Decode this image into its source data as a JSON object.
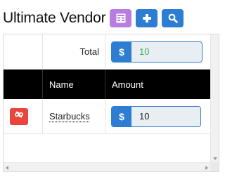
{
  "header": {
    "title": "Ultimate Vendor",
    "buttons": [
      {
        "icon": "table-icon",
        "color": "#b77ee0"
      },
      {
        "icon": "plus-icon",
        "color": "#2d7dd2"
      },
      {
        "icon": "search-icon",
        "color": "#2d7dd2"
      }
    ]
  },
  "table": {
    "total_label": "Total",
    "total": {
      "currency_symbol": "$",
      "value": "10",
      "value_color": "#3fae5a"
    },
    "columns": [
      "",
      "Name",
      "Amount"
    ],
    "rows": [
      {
        "name": "Starbucks",
        "currency_symbol": "$",
        "amount": "10",
        "delete_icon": "unlink-icon"
      }
    ]
  },
  "colors": {
    "accent_blue": "#2d7dd2",
    "accent_purple": "#b77ee0",
    "danger_red": "#e8453c",
    "header_bg": "#000000"
  }
}
